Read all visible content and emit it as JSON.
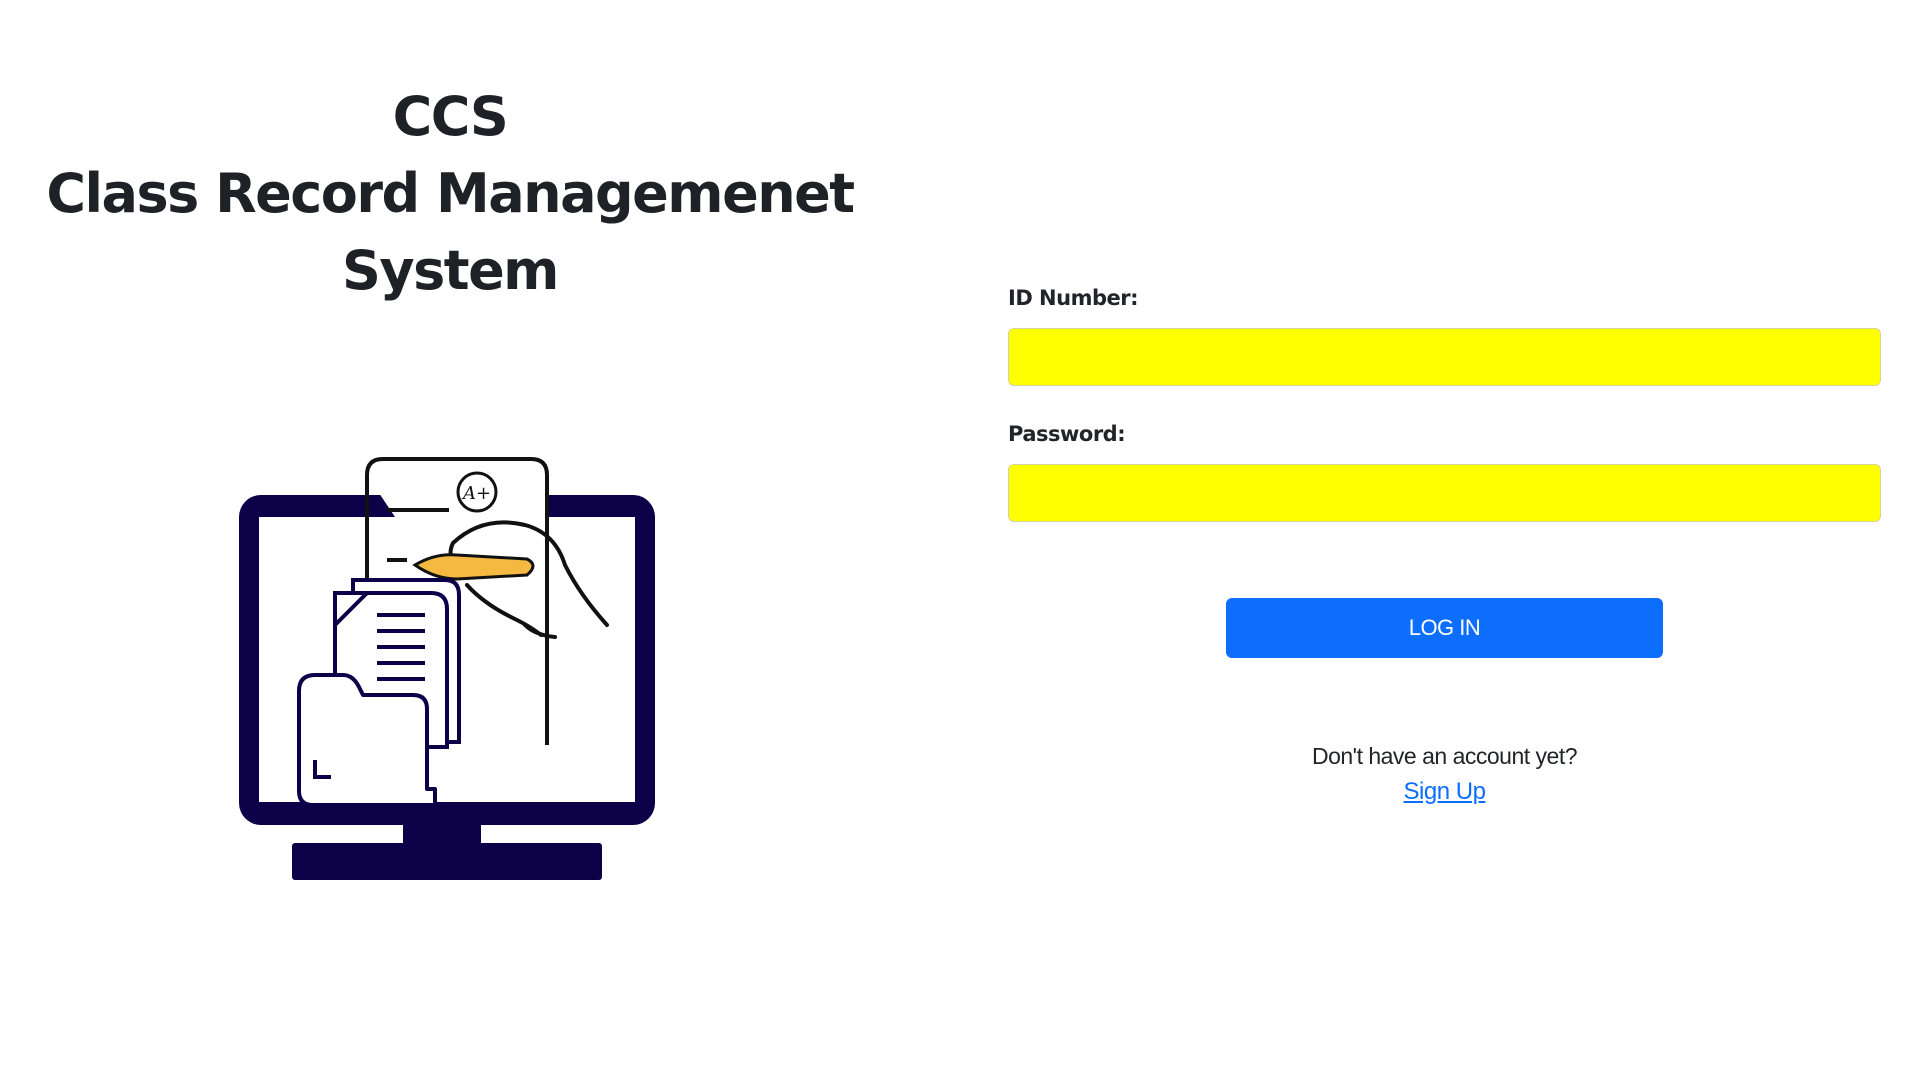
{
  "header": {
    "title_lines": [
      "CCS",
      "Class Record Managemenet",
      "System"
    ]
  },
  "illustration": {
    "icon": "computer-grading-icon",
    "grade_text": "A+",
    "colors": {
      "monitor": "#0c0049",
      "pencil": "#f5b942",
      "outline": "#111111"
    }
  },
  "login_form": {
    "id_label": "ID Number:",
    "id_value": "",
    "password_label": "Password:",
    "password_value": "",
    "login_button_label": "LOG IN",
    "signup_prompt": "Don't have an account yet?",
    "signup_link_label": "Sign Up"
  },
  "colors": {
    "input_background": "#ffff00",
    "primary_button": "#0d6efd",
    "link": "#0d6efd",
    "title_text": "#1e2126"
  }
}
